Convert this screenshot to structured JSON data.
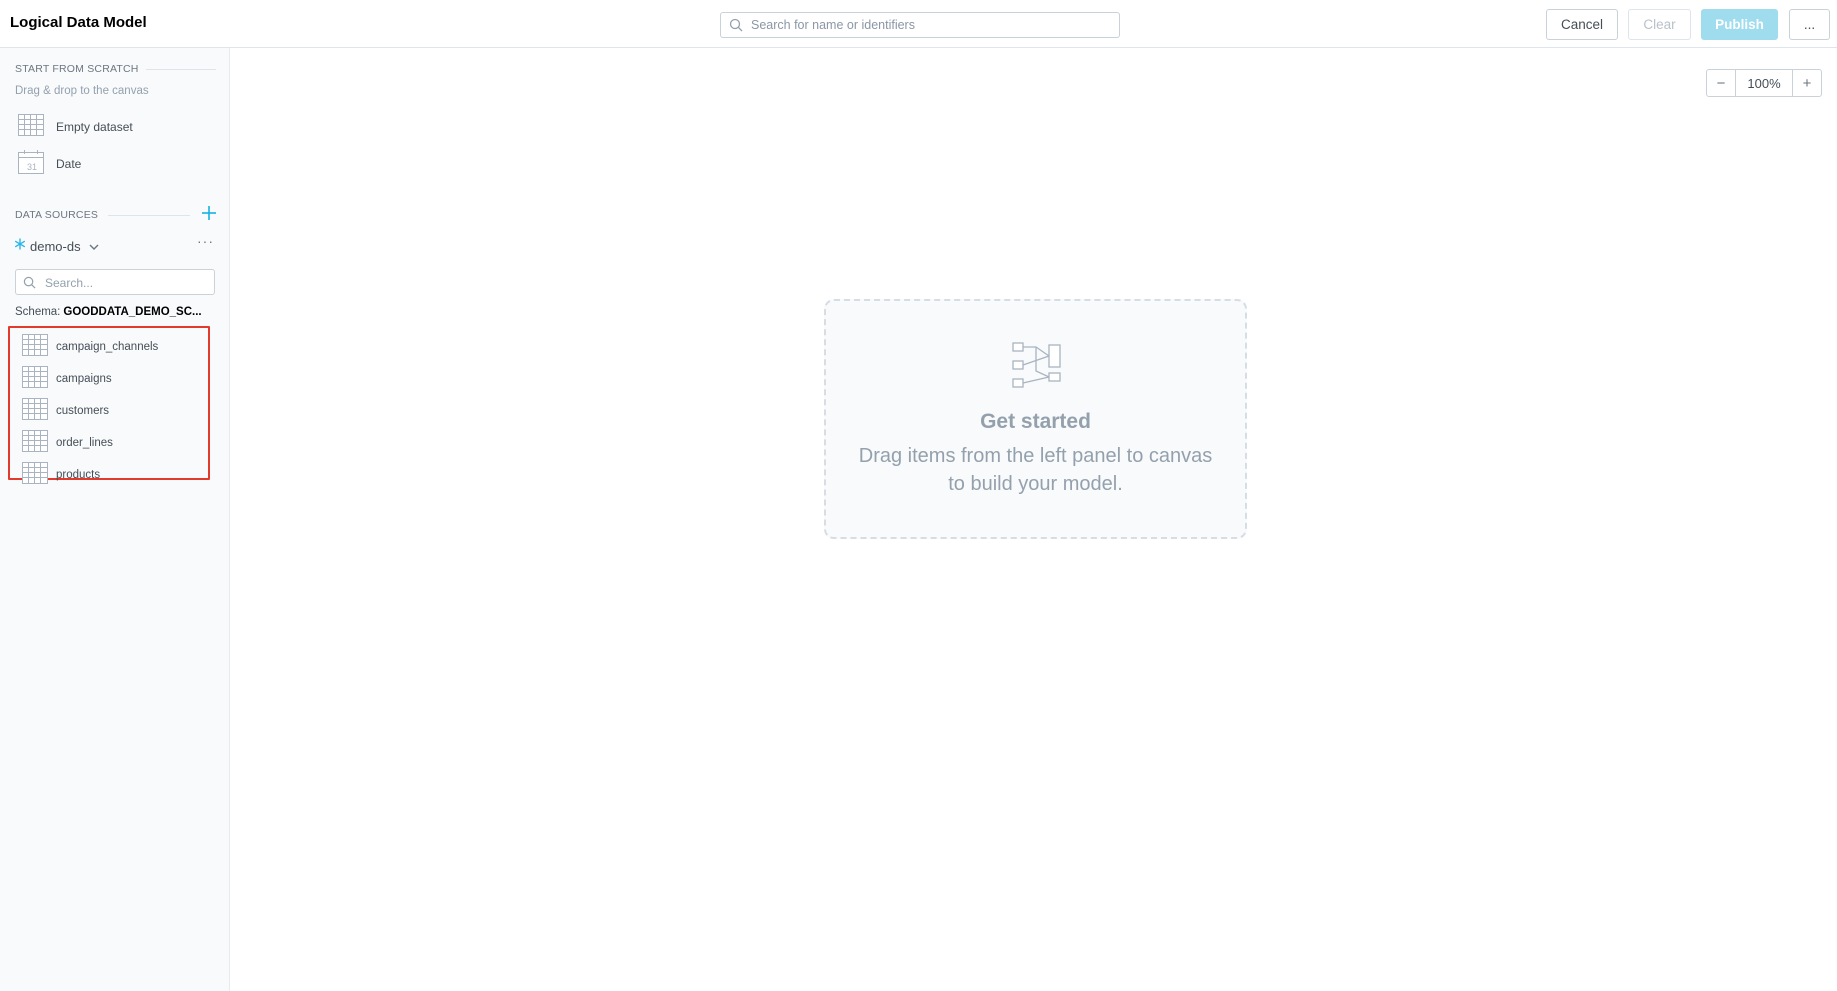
{
  "header": {
    "title": "Logical Data Model",
    "search_placeholder": "Search for name or identifiers",
    "cancel_label": "Cancel",
    "clear_label": "Clear",
    "publish_label": "Publish",
    "more_label": "..."
  },
  "sidebar": {
    "scratch_title": "START FROM SCRATCH",
    "scratch_hint": "Drag & drop to the canvas",
    "scratch_items": [
      {
        "label": "Empty dataset",
        "icon": "table-icon"
      },
      {
        "label": "Date",
        "icon": "calendar-icon"
      }
    ],
    "datasources_title": "DATA SOURCES",
    "datasource": {
      "name": "demo-ds",
      "icon": "snowflake-icon"
    },
    "datasource_more": "···",
    "search_placeholder": "Search...",
    "schema_label": "Schema:",
    "schema_name": "GOODDATA_DEMO_SC...",
    "tables": [
      {
        "label": "campaign_channels"
      },
      {
        "label": "campaigns"
      },
      {
        "label": "customers"
      },
      {
        "label": "order_lines"
      },
      {
        "label": "products"
      }
    ]
  },
  "canvas": {
    "zoom_out": "−",
    "zoom_value": "100%",
    "zoom_in": "+",
    "empty_title": "Get started",
    "empty_desc": "Drag items from the left panel to canvas to build your model."
  },
  "colors": {
    "accent": "#14b2e2",
    "publish_disabled": "#9fdcee",
    "highlight_border": "#e33a2e"
  }
}
